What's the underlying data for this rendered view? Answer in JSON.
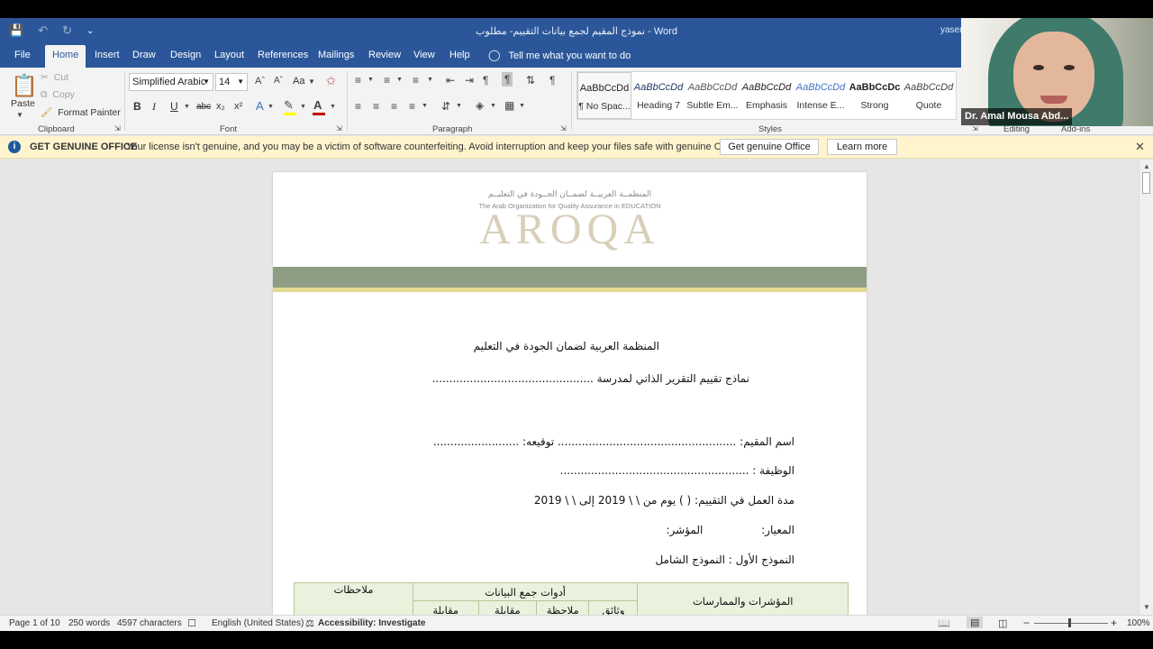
{
  "window": {
    "title": "نموذج المقيم لجمع بيانات التقييم- مطلوب  -  Word",
    "user": "yaser"
  },
  "tabs": [
    "File",
    "Home",
    "Insert",
    "Draw",
    "Design",
    "Layout",
    "References",
    "Mailings",
    "Review",
    "View",
    "Help"
  ],
  "tell_me": "Tell me what you want to do",
  "clipboard": {
    "paste": "Paste",
    "cut": "Cut",
    "copy": "Copy",
    "format_painter": "Format Painter",
    "label": "Clipboard"
  },
  "font": {
    "family": "Simplified Arabic",
    "size": "14",
    "label": "Font",
    "case": "Aa",
    "bold": "B",
    "italic": "I",
    "underline": "U",
    "strike": "abc",
    "sub": "x₂",
    "sup": "x²",
    "highlight_color": "#ffff00",
    "font_color": "#c00000"
  },
  "paragraph": {
    "label": "Paragraph"
  },
  "styles": {
    "label": "Styles",
    "items": [
      {
        "sample": "AaBbCcDd",
        "name": "¶ No Spac..."
      },
      {
        "sample": "AaBbCcDd",
        "name": "Heading 7"
      },
      {
        "sample": "AaBbCcDd",
        "name": "Subtle Em..."
      },
      {
        "sample": "AaBbCcDd",
        "name": "Emphasis"
      },
      {
        "sample": "AaBbCcDd",
        "name": "Intense E..."
      },
      {
        "sample": "AaBbCcDc",
        "name": "Strong"
      },
      {
        "sample": "AaBbCcDd",
        "name": "Quote"
      }
    ]
  },
  "editing": {
    "label": "Editing"
  },
  "addins": {
    "label": "Add-ins"
  },
  "banner": {
    "heading": "GET GENUINE OFFICE",
    "message": "Your license isn't genuine, and you may be a victim of software counterfeiting. Avoid interruption and keep your files safe with genuine Office today.",
    "btn_genuine": "Get genuine Office",
    "btn_learn": "Learn more"
  },
  "document": {
    "logo_ar": "المنظمــة العربيــة لضمــان الجــودة في التعليــم",
    "logo_en": "The Arab Organization for Quality Assurance in EDUCATION",
    "logo_big": "AROQA",
    "org_line": "المنظمة العربية لضمان الجودة في التعليم",
    "subtitle": "نماذج تقييم التقرير الذاتي لمدرسة ...............................................",
    "evaluator_line": "اسم المقيم: ....................................................  توقيعه: .........................",
    "job_line": "الوظيفة : .......................................................",
    "duration_line": "مدة العمل في التقييم:   (       ) يوم   من    \\     \\ 2019  إلى   \\     \\  2019",
    "standard_line": "المعيار:                 المؤشر:",
    "model_line": "النموذج الأول : النموذج الشامل",
    "table": {
      "col_indicators": "المؤشرات والممارسات",
      "col_tools": "أدوات جمع البيانات",
      "col_notes": "ملاحظات",
      "sub_docs": "وثائق",
      "sub_observation": "ملاحظة",
      "sub_interview1": "مقابلة",
      "sub_interview2": "مقابلة"
    }
  },
  "status": {
    "page": "Page 1 of 10",
    "words": "250 words",
    "chars": "4597 characters",
    "language": "English (United States)",
    "accessibility": "Accessibility: Investigate",
    "zoom": "100%"
  },
  "webcam": {
    "name": "Dr. Amal Mousa Abd..."
  }
}
